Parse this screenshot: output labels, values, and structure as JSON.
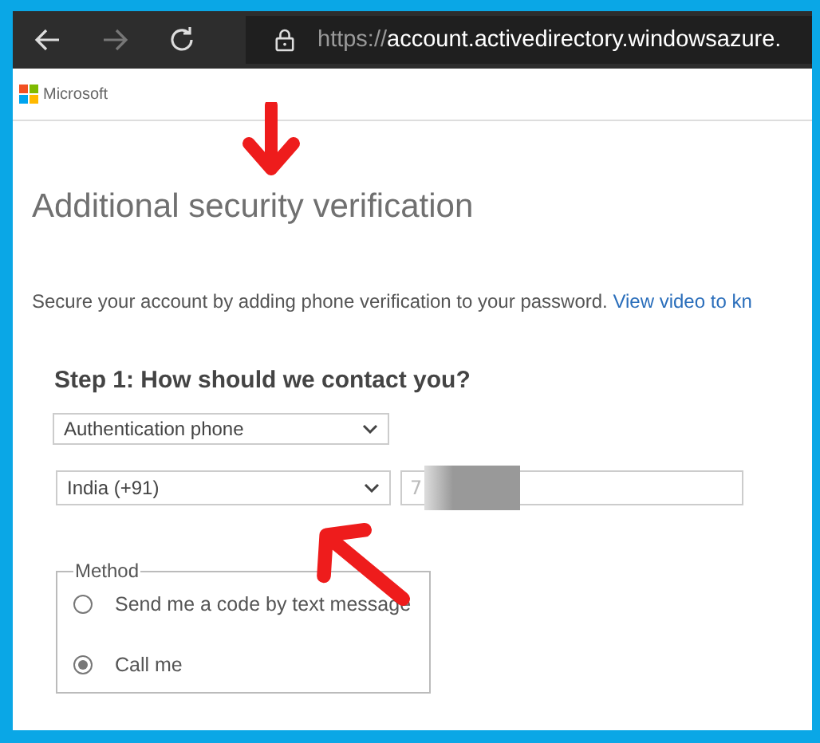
{
  "browser": {
    "url_scheme": "https://",
    "url_host": "account.activedirectory.windowsazure."
  },
  "header": {
    "brand": "Microsoft"
  },
  "page": {
    "title": "Additional security verification",
    "description": "Secure your account by adding phone verification to your password.",
    "link": "View video to kn"
  },
  "step": {
    "heading": "Step 1: How should we contact you?",
    "contact_type": "Authentication phone",
    "country": "India (+91)",
    "phone": "7"
  },
  "method": {
    "legend": "Method",
    "options": [
      {
        "label": "Send me a code by text message",
        "selected": false
      },
      {
        "label": "Call me",
        "selected": true
      }
    ]
  }
}
